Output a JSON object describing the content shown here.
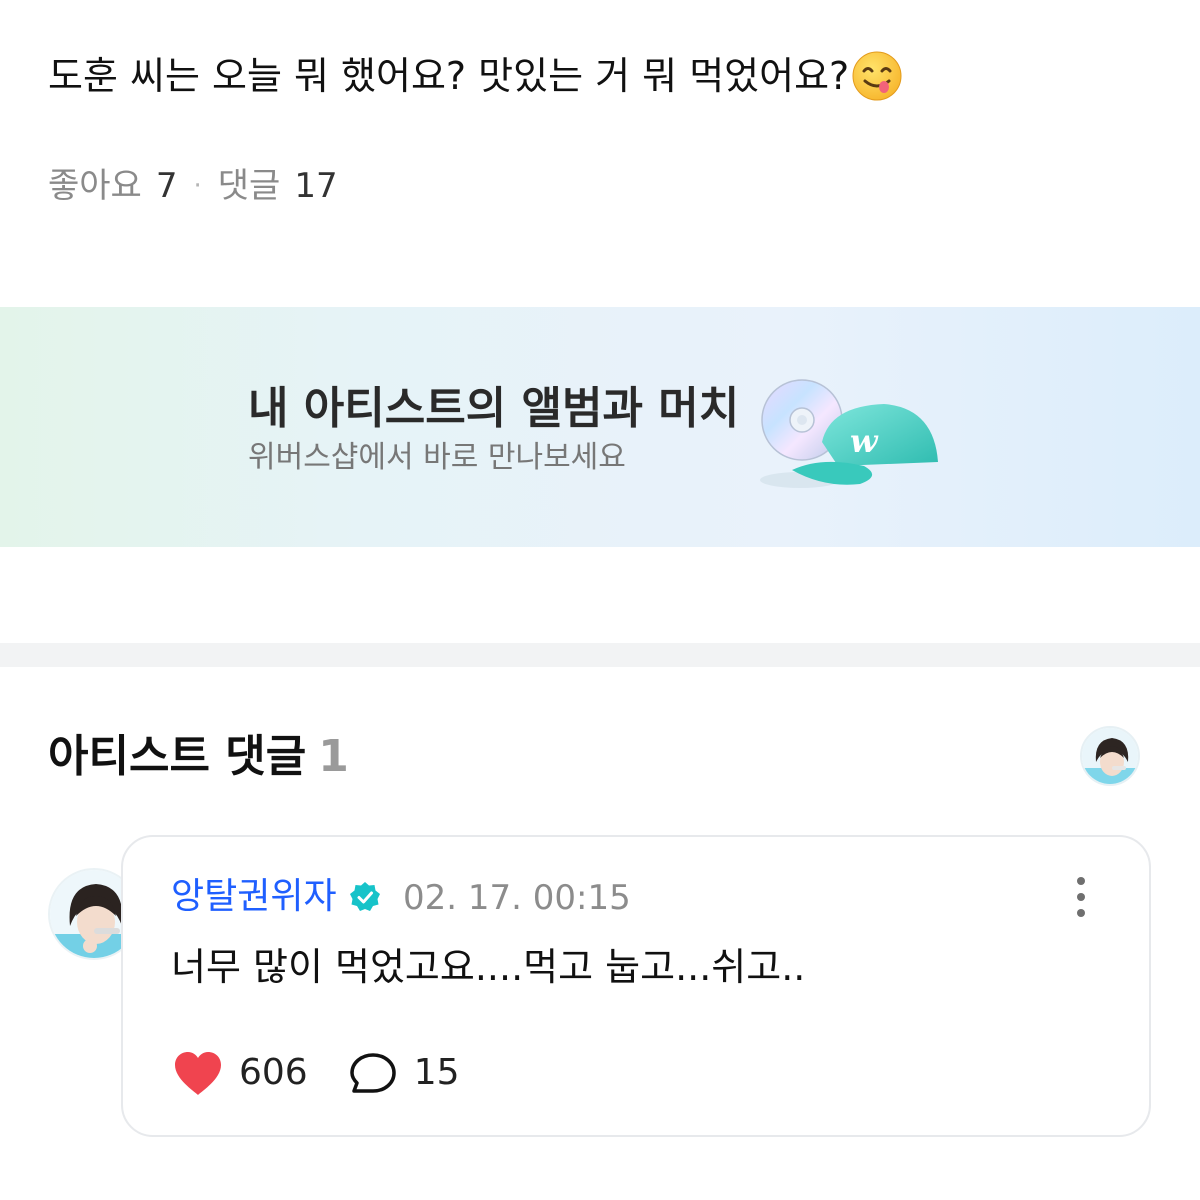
{
  "post": {
    "text": "도훈 씨는 오늘 뭐 했어요? 맛있는 거 뭐 먹었어요?",
    "emoji": "face-savoring-food-emoji",
    "likes_label": "좋아요",
    "likes_count": "7",
    "separator": "·",
    "comments_label": "댓글",
    "comments_count": "17"
  },
  "banner": {
    "title": "내 아티스트의 앨범과 머치",
    "subtitle": "위버스샵에서 바로 만나보세요",
    "cap_logo": "w"
  },
  "artist_comments": {
    "title": "아티스트 댓글",
    "count": "1"
  },
  "comment": {
    "author": "앙탈권위자",
    "time": "02. 17. 00:15",
    "text": "너무 많이 먹었고요....먹고 눕고...쉬고..",
    "likes": "606",
    "replies": "15"
  },
  "colors": {
    "author": "#1f5fff",
    "verified": "#17c3c9",
    "heart": "#f0444f",
    "banner_start": "#e3f4ea",
    "banner_end": "#dcedfb"
  }
}
